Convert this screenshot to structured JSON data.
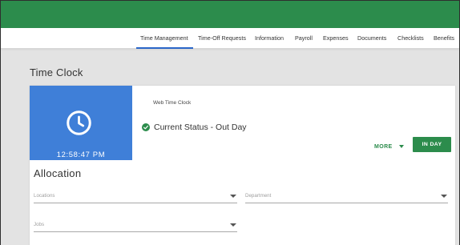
{
  "nav": {
    "tabs": [
      {
        "label": "Time Management",
        "active": true
      },
      {
        "label": "Time-Off Requests",
        "active": false
      },
      {
        "label": "Information",
        "active": false
      },
      {
        "label": "Payroll",
        "active": false
      },
      {
        "label": "Expenses",
        "active": false
      },
      {
        "label": "Documents",
        "active": false
      },
      {
        "label": "Checklists",
        "active": false
      },
      {
        "label": "Benefits",
        "active": false
      }
    ]
  },
  "page": {
    "title": "Time Clock"
  },
  "clock": {
    "icon": "clock-icon",
    "time": "12:58:47 PM",
    "web_label": "Web Time Clock",
    "status_icon": "check-circle-icon",
    "status_text": "Current Status - Out Day"
  },
  "actions": {
    "more_label": "MORE",
    "in_day_label": "IN DAY"
  },
  "allocation": {
    "title": "Allocation",
    "locations_placeholder": "Locations",
    "department_placeholder": "Department",
    "jobs_placeholder": "Jobs"
  },
  "colors": {
    "brand_green": "#2c8c4c",
    "clock_blue": "#3f7fd8",
    "active_tab": "#2a66c8"
  }
}
